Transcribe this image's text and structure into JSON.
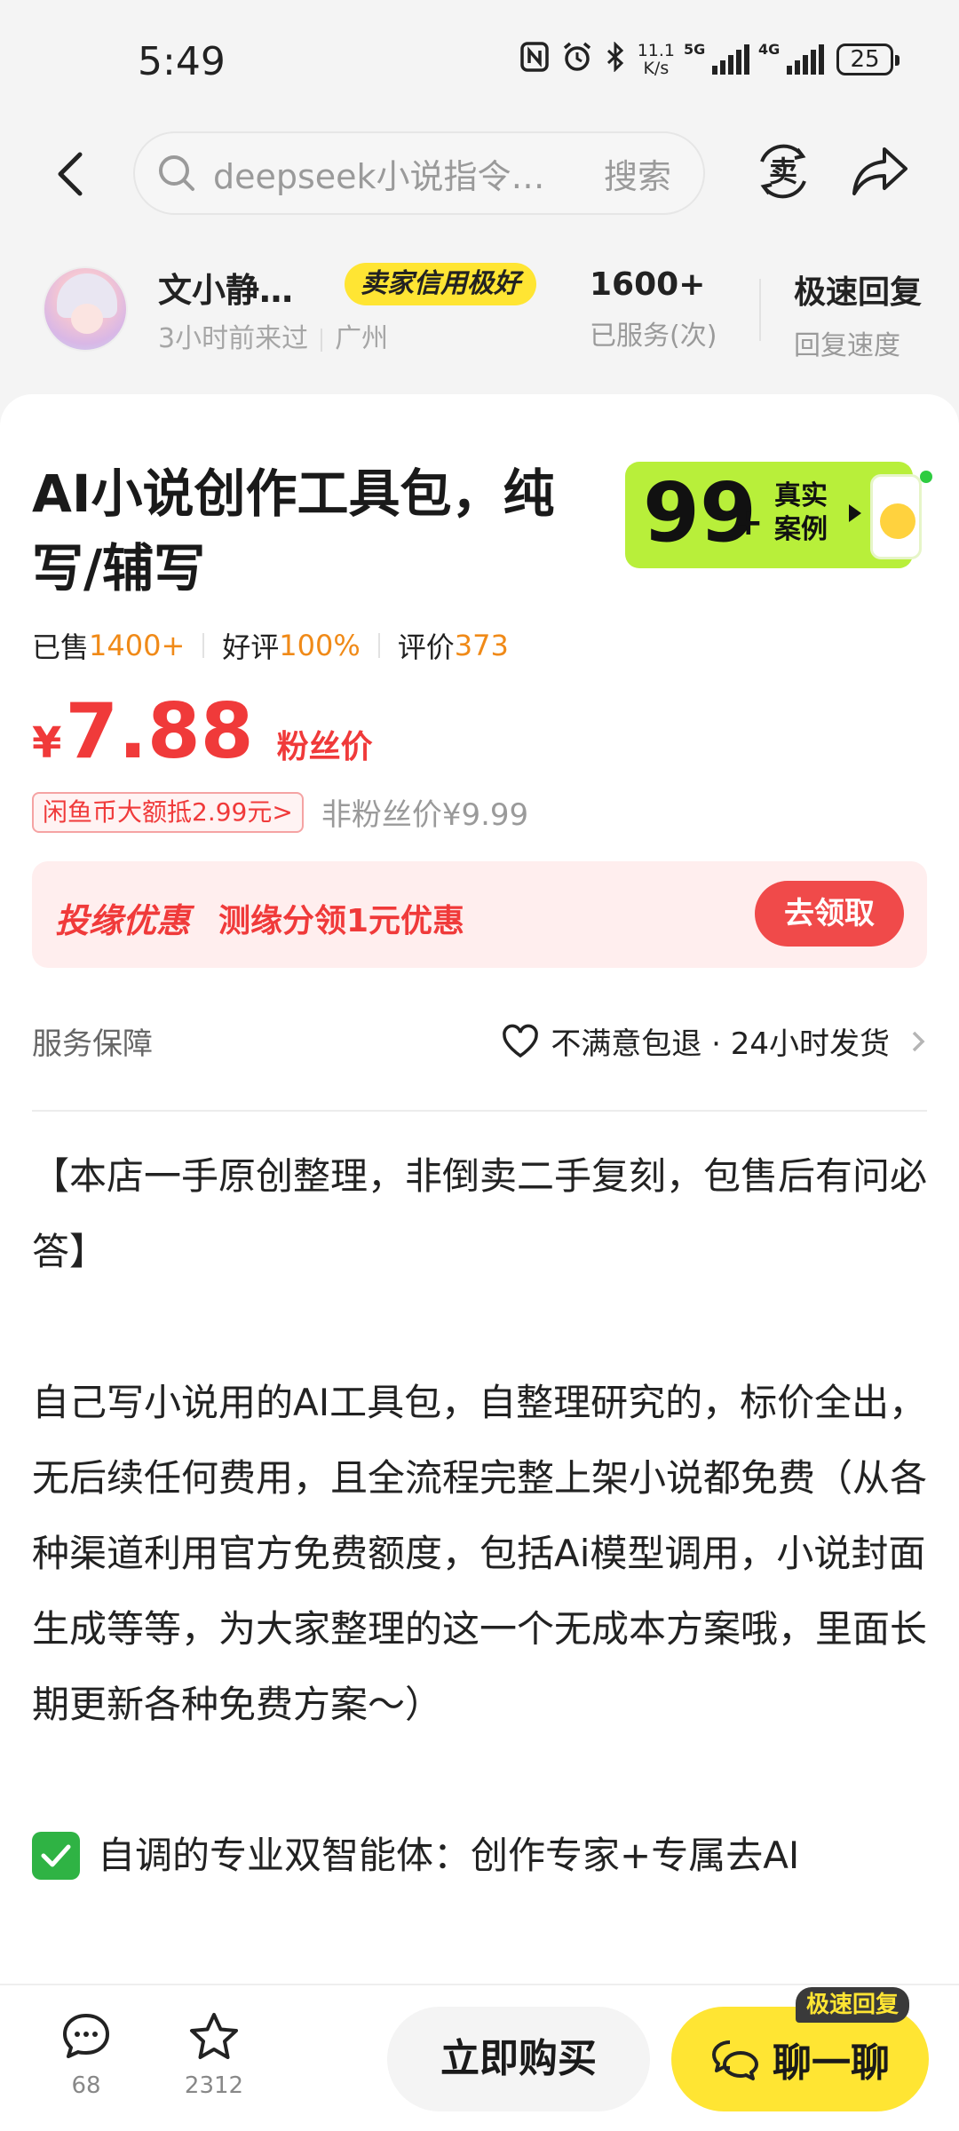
{
  "status_bar": {
    "time": "5:49",
    "net_speed_value": "11.1",
    "net_speed_unit": "K/s",
    "sim1_label": "5G",
    "sim2_label": "4G",
    "battery": "25"
  },
  "nav": {
    "search_placeholder": "deepseek小说指令…",
    "search_button": "搜索",
    "sell_icon_text": "卖"
  },
  "seller": {
    "name": "文小静…",
    "credit_badge": "卖家信用极好",
    "last_seen": "3小时前来过",
    "location": "广州",
    "served_value": "1600+",
    "served_label": "已服务(次)",
    "reply_value": "极速回复",
    "reply_label": "回复速度"
  },
  "product": {
    "title": "AI小说创作工具包，纯写/辅写",
    "cases_banner": {
      "number": "99",
      "plus": "+",
      "line1": "真实",
      "line2": "案例"
    },
    "metrics": {
      "sold_label": "已售",
      "sold_value": "1400+",
      "rating_label": "好评",
      "rating_value": "100%",
      "reviews_label": "评价",
      "reviews_value": "373"
    },
    "price": {
      "currency": "¥",
      "value": "7.88",
      "tag": "粉丝价"
    },
    "coin_badge": "闲鱼币大额抵2.99元",
    "coin_badge_arrow": ">",
    "non_fan_price": "非粉丝价¥9.99"
  },
  "promo": {
    "title": "投缘优惠",
    "text": "测缘分领1元优惠",
    "button": "去领取"
  },
  "service": {
    "label": "服务保障",
    "items": "不满意包退 · 24小时发货"
  },
  "description": {
    "paragraph1": "【本店一手原创整理，非倒卖二手复刻，包售后有问必答】",
    "paragraph2": "自己写小说用的AI工具包，自整理研究的，标价全出，无后续任何费用，且全流程完整上架小说都免费（从各种渠道利用官方免费额度，包括Ai模型调用，小说封面生成等等，为大家整理的这一个无成本方案哦，里面长期更新各种免费方案～）",
    "feature1": "自调的专业双智能体：创作专家+专属去AI"
  },
  "bottom_bar": {
    "comments_count": "68",
    "favorites_count": "2312",
    "buy_button": "立即购买",
    "chat_button": "聊一聊",
    "fast_reply_badge": "极速回复"
  },
  "colors": {
    "accent_yellow": "#ffe533",
    "price_red": "#f03a3a",
    "stat_orange": "#f08a18",
    "case_green": "#b8ef3a"
  }
}
